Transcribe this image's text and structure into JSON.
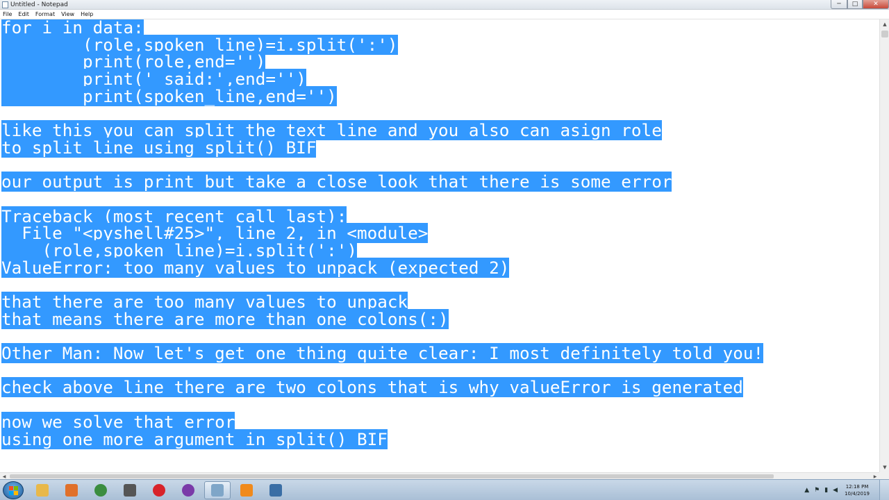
{
  "window": {
    "title": "Untitled - Notepad",
    "minimize": "─",
    "maximize": "□",
    "close": "✕"
  },
  "menu": [
    "File",
    "Edit",
    "Format",
    "View",
    "Help"
  ],
  "document": {
    "lines": [
      "for i in data:",
      "        (role,spoken_line)=i.split(':')",
      "        print(role,end='')",
      "        print(' said:',end='')",
      "        print(spoken_line,end='')",
      "",
      "like this you can split the text line and you also can asign role",
      "to split line using split() BIF",
      "",
      "our output is print but take a close look that there is some error",
      "",
      "Traceback (most recent call last):",
      "  File \"<pyshell#25>\", line 2, in <module>",
      "    (role,spoken_line)=i.split(':')",
      "ValueError: too many values to unpack (expected 2)",
      "",
      "that there are too many values to unpack",
      "that means there are more than one colons(:)",
      "",
      "Other Man: Now let's get one thing quite clear: I most definitely told you!",
      "",
      "check above line there are two colons that is why valueError is generated",
      "",
      "now we solve that error",
      "using one more argument in split() BIF"
    ]
  },
  "taskbar": {
    "apps": [
      {
        "name": "windows-explorer",
        "color": "#e8b84a",
        "active": false
      },
      {
        "name": "media-player",
        "color": "#e0702a",
        "active": false
      },
      {
        "name": "chrome",
        "color": "#3b8d3f",
        "active": false
      },
      {
        "name": "keyboard-tool",
        "color": "#555555",
        "active": false
      },
      {
        "name": "recorder",
        "color": "#d8232a",
        "active": false
      },
      {
        "name": "globe-app",
        "color": "#7a3aa8",
        "active": false
      },
      {
        "name": "notepad-window",
        "color": "#7fa6c8",
        "active": true
      },
      {
        "name": "vlc",
        "color": "#f08a1c",
        "active": false
      },
      {
        "name": "python-idle",
        "color": "#3a6ea5",
        "active": false
      }
    ],
    "time": "12:18 PM",
    "date": "10/4/2019"
  }
}
